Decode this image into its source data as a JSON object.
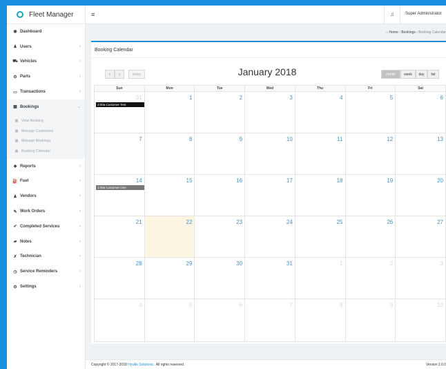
{
  "app": {
    "title": "Fleet Manager"
  },
  "topbar": {
    "menu_icon": "≡",
    "bell_icon": "bell-icon",
    "user": "Super Administrator"
  },
  "breadcrumb": {
    "home": "Home",
    "section": "Bookings",
    "current": "Booking Calendar"
  },
  "sidebar": {
    "items": [
      {
        "label": "Dashboard",
        "icon": "◉",
        "chevron": ""
      },
      {
        "label": "Users",
        "icon": "♟",
        "chevron": "‹"
      },
      {
        "label": "Vehicles",
        "icon": "⛟",
        "chevron": "‹"
      },
      {
        "label": "Parts",
        "icon": "⚙",
        "chevron": "‹"
      },
      {
        "label": "Transactions",
        "icon": "▭",
        "chevron": "‹"
      },
      {
        "label": "Bookings",
        "icon": "▦",
        "chevron": "⌄"
      }
    ],
    "bookings_sub": [
      {
        "label": "View Booking",
        "icon": "▦"
      },
      {
        "label": "Manage Customers",
        "icon": "▦"
      },
      {
        "label": "Manage Bookings",
        "icon": "▦"
      },
      {
        "label": "Booking Calendar",
        "icon": "▦"
      }
    ],
    "items_after": [
      {
        "label": "Reports",
        "icon": "◆",
        "chevron": "‹"
      },
      {
        "label": "Fuel",
        "icon": "⛽",
        "chevron": "‹"
      },
      {
        "label": "Vendors",
        "icon": "♟",
        "chevron": "‹"
      },
      {
        "label": "Work Orders",
        "icon": "✎",
        "chevron": "‹"
      },
      {
        "label": "Completed Services",
        "icon": "✔",
        "chevron": "‹"
      },
      {
        "label": "Notes",
        "icon": "▰",
        "chevron": "‹"
      },
      {
        "label": "Technician",
        "icon": "✗",
        "chevron": "‹"
      },
      {
        "label": "Service Reminders",
        "icon": "◷",
        "chevron": "‹"
      },
      {
        "label": "Settings",
        "icon": "⚙",
        "chevron": "‹"
      }
    ]
  },
  "calendar": {
    "card_title": "Booking Calendar",
    "title": "January 2018",
    "prev": "‹",
    "next": "›",
    "today": "today",
    "views": [
      "month",
      "week",
      "day",
      "list"
    ],
    "days": [
      "Sun",
      "Mon",
      "Tue",
      "Wed",
      "Thu",
      "Fri",
      "Sat"
    ],
    "weeks": [
      [
        {
          "d": "31",
          "o": true
        },
        {
          "d": "1"
        },
        {
          "d": "2"
        },
        {
          "d": "3"
        },
        {
          "d": "4"
        },
        {
          "d": "5"
        },
        {
          "d": "6"
        }
      ],
      [
        {
          "d": "7"
        },
        {
          "d": "8"
        },
        {
          "d": "9"
        },
        {
          "d": "10"
        },
        {
          "d": "11"
        },
        {
          "d": "12"
        },
        {
          "d": "13"
        }
      ],
      [
        {
          "d": "14"
        },
        {
          "d": "15"
        },
        {
          "d": "16"
        },
        {
          "d": "17"
        },
        {
          "d": "18"
        },
        {
          "d": "19"
        },
        {
          "d": "20"
        }
      ],
      [
        {
          "d": "21"
        },
        {
          "d": "22",
          "today": true
        },
        {
          "d": "23"
        },
        {
          "d": "24"
        },
        {
          "d": "25"
        },
        {
          "d": "26"
        },
        {
          "d": "27"
        }
      ],
      [
        {
          "d": "28"
        },
        {
          "d": "29"
        },
        {
          "d": "30"
        },
        {
          "d": "31"
        },
        {
          "d": "1",
          "o": true
        },
        {
          "d": "2",
          "o": true
        },
        {
          "d": "3",
          "o": true
        }
      ],
      [
        {
          "d": "4",
          "o": true
        },
        {
          "d": "5",
          "o": true
        },
        {
          "d": "6",
          "o": true
        },
        {
          "d": "7",
          "o": true
        },
        {
          "d": "8",
          "o": true
        },
        {
          "d": "9",
          "o": true
        },
        {
          "d": "10",
          "o": true
        }
      ]
    ],
    "events": [
      {
        "week": 0,
        "label": "3:00a Customer Test",
        "color": "#111111"
      },
      {
        "week": 2,
        "label": "1:00a Customer One",
        "color": "#777777"
      }
    ]
  },
  "footer": {
    "copyright": "Copyright © 2017-2018",
    "company": "Hyvikk Solutions",
    "rights": ". All rights reserved.",
    "version": "Version 2.0.0"
  }
}
